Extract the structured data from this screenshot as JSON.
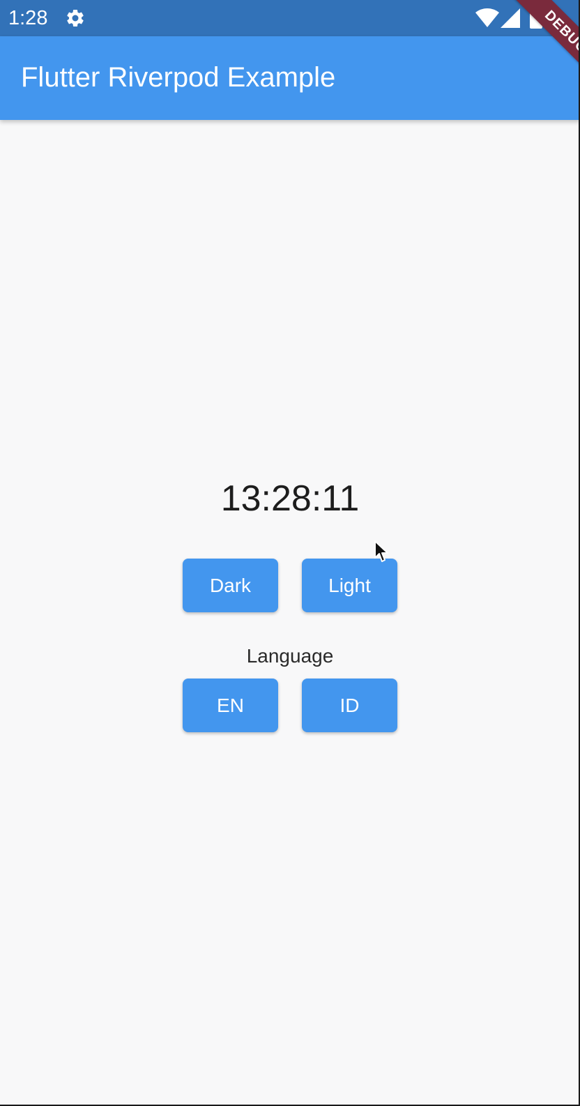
{
  "status_bar": {
    "time": "1:28",
    "icons": [
      "gear-icon",
      "wifi-icon",
      "signal-icon",
      "battery-icon"
    ],
    "background_color": "#3272b8"
  },
  "app_bar": {
    "title": "Flutter Riverpod Example",
    "background_color": "#4396ee"
  },
  "debug_banner": {
    "label": "DEBUG",
    "color": "#7a2a3c"
  },
  "main": {
    "clock": "13:28:11",
    "theme_buttons": {
      "dark_label": "Dark",
      "light_label": "Light"
    },
    "language_label": "Language",
    "language_buttons": {
      "en_label": "EN",
      "id_label": "ID"
    },
    "button_color": "#4396ee",
    "background_color": "#f8f8f9"
  }
}
